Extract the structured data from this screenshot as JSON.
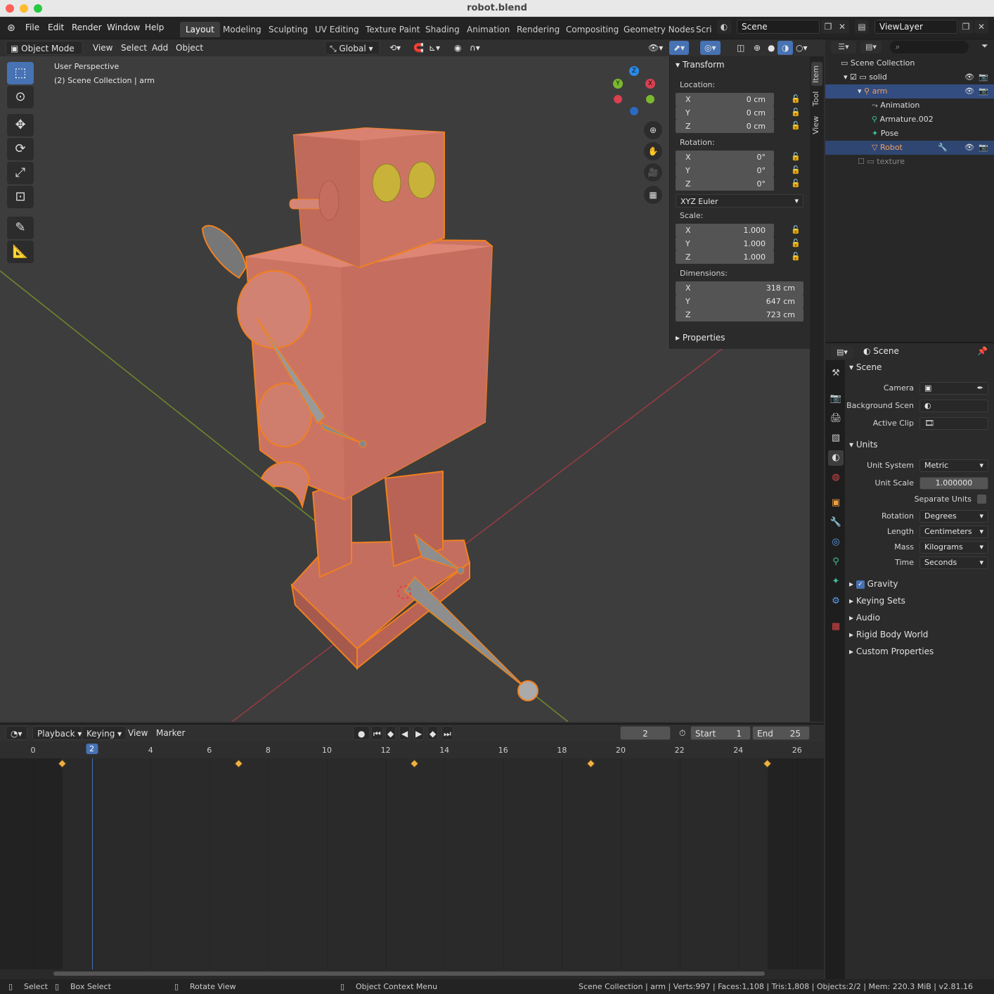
{
  "window": {
    "title": "robot.blend"
  },
  "topbar": {
    "menus": [
      "File",
      "Edit",
      "Render",
      "Window",
      "Help"
    ],
    "workspaces": [
      "Layout",
      "Modeling",
      "Sculpting",
      "UV Editing",
      "Texture Paint",
      "Shading",
      "Animation",
      "Rendering",
      "Compositing",
      "Geometry Nodes",
      "Scri"
    ],
    "scene": "Scene",
    "view_layer": "ViewLayer"
  },
  "viewport_header": {
    "mode": "Object Mode",
    "menus": [
      "View",
      "Select",
      "Add",
      "Object"
    ],
    "orientation": "Global"
  },
  "viewport": {
    "perspective": "User Perspective",
    "collection": "(2) Scene Collection | arm",
    "gizmo": {
      "z": "Z",
      "y": "Y",
      "x": "X"
    }
  },
  "npanel": {
    "transform_title": "Transform",
    "location_label": "Location:",
    "location": [
      {
        "axis": "X",
        "value": "0 cm"
      },
      {
        "axis": "Y",
        "value": "0 cm"
      },
      {
        "axis": "Z",
        "value": "0 cm"
      }
    ],
    "rotation_label": "Rotation:",
    "rotation": [
      {
        "axis": "X",
        "value": "0°"
      },
      {
        "axis": "Y",
        "value": "0°"
      },
      {
        "axis": "Z",
        "value": "0°"
      }
    ],
    "rotation_mode": "XYZ Euler",
    "scale_label": "Scale:",
    "scale": [
      {
        "axis": "X",
        "value": "1.000"
      },
      {
        "axis": "Y",
        "value": "1.000"
      },
      {
        "axis": "Z",
        "value": "1.000"
      }
    ],
    "dimensions_label": "Dimensions:",
    "dimensions": [
      {
        "axis": "X",
        "value": "318 cm"
      },
      {
        "axis": "Y",
        "value": "647 cm"
      },
      {
        "axis": "Z",
        "value": "723 cm"
      }
    ],
    "properties_title": "Properties",
    "tabs": [
      "Item",
      "Tool",
      "View"
    ]
  },
  "outliner": {
    "items": [
      "Scene Collection",
      "solid",
      "arm",
      "Animation",
      "Armature.002",
      "Pose",
      "Robot",
      "texture"
    ]
  },
  "properties": {
    "context": "Scene",
    "scene_section": "Scene",
    "camera_label": "Camera",
    "background_label": "Background Scen",
    "active_clip_label": "Active Clip",
    "units_section": "Units",
    "unit_system_label": "Unit System",
    "unit_system": "Metric",
    "unit_scale_label": "Unit Scale",
    "unit_scale": "1.000000",
    "separate_units": "Separate Units",
    "rotation_label": "Rotation",
    "rotation": "Degrees",
    "length_label": "Length",
    "length": "Centimeters",
    "mass_label": "Mass",
    "mass": "Kilograms",
    "time_label": "Time",
    "time": "Seconds",
    "sections": [
      "Gravity",
      "Keying Sets",
      "Audio",
      "Rigid Body World",
      "Custom Properties"
    ]
  },
  "timeline": {
    "menus": [
      "Playback",
      "Keying",
      "View",
      "Marker"
    ],
    "current_frame": "2",
    "start_label": "Start",
    "start": "1",
    "end_label": "End",
    "end": "25",
    "ruler": [
      "0",
      "2",
      "4",
      "6",
      "8",
      "10",
      "12",
      "14",
      "16",
      "18",
      "20",
      "22",
      "24",
      "26"
    ],
    "keyframes": [
      1,
      7,
      13,
      19,
      25
    ]
  },
  "statusbar": {
    "select": "Select",
    "box_select": "Box Select",
    "rotate_view": "Rotate View",
    "context_menu": "Object Context Menu",
    "stats": "Scene Collection | arm | Verts:997 | Faces:1,108 | Tris:1,808 | Objects:2/2 | Mem: 220.3 MiB | v2.81.16"
  },
  "colors": {
    "accent": "#4772b3",
    "selected_outline": "#f08020",
    "robot": "#d27a6a",
    "keyframe": "#f0b040"
  }
}
